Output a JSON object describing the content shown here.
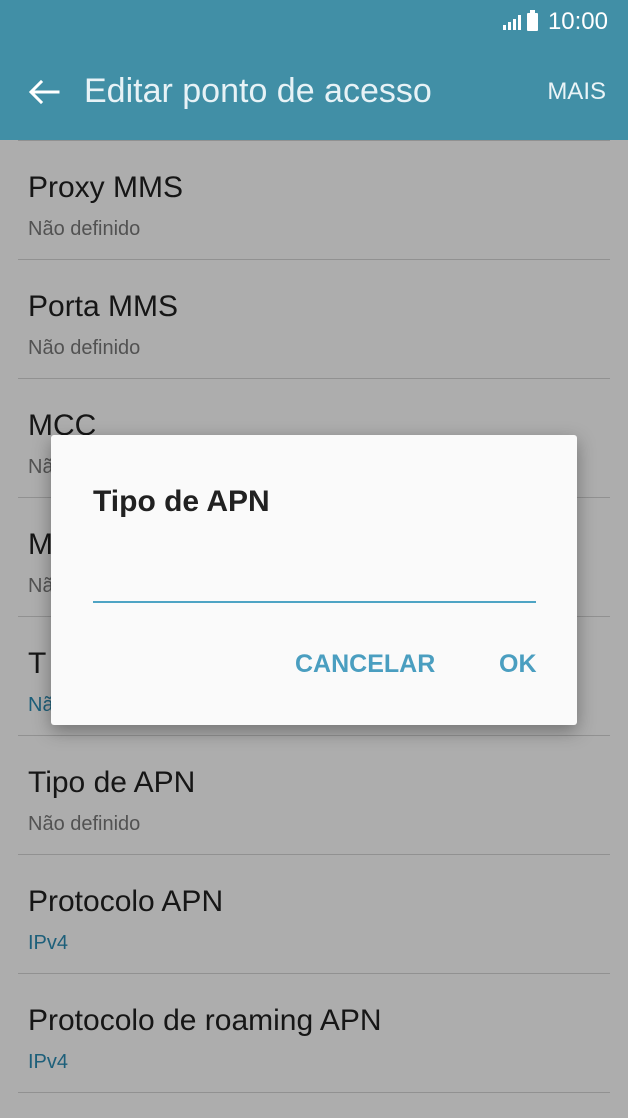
{
  "status_bar": {
    "time": "10:00",
    "signal_icon": "signal-icon",
    "battery_icon": "battery-icon"
  },
  "app_bar": {
    "title": "Editar ponto de acesso",
    "more_label": "MAIS",
    "back_icon": "arrow-left-icon"
  },
  "settings": [
    {
      "label": "Proxy MMS",
      "value": "Não definido",
      "accent": false
    },
    {
      "label": "Porta MMS",
      "value": "Não definido",
      "accent": false
    },
    {
      "label": "MCC",
      "value": "Nã",
      "accent": false
    },
    {
      "label": "M",
      "value": "Nã",
      "accent": false
    },
    {
      "label": "T",
      "value": "Nã",
      "accent": true
    },
    {
      "label": "Tipo de APN",
      "value": "Não definido",
      "accent": false
    },
    {
      "label": "Protocolo APN",
      "value": "IPv4",
      "accent": true
    },
    {
      "label": "Protocolo de roaming APN",
      "value": "IPv4",
      "accent": true
    }
  ],
  "dialog": {
    "title": "Tipo de APN",
    "input_value": "",
    "cancel_label": "CANCELAR",
    "ok_label": "OK"
  },
  "colors": {
    "header": "#418fa6",
    "accent": "#4a9ec0"
  }
}
